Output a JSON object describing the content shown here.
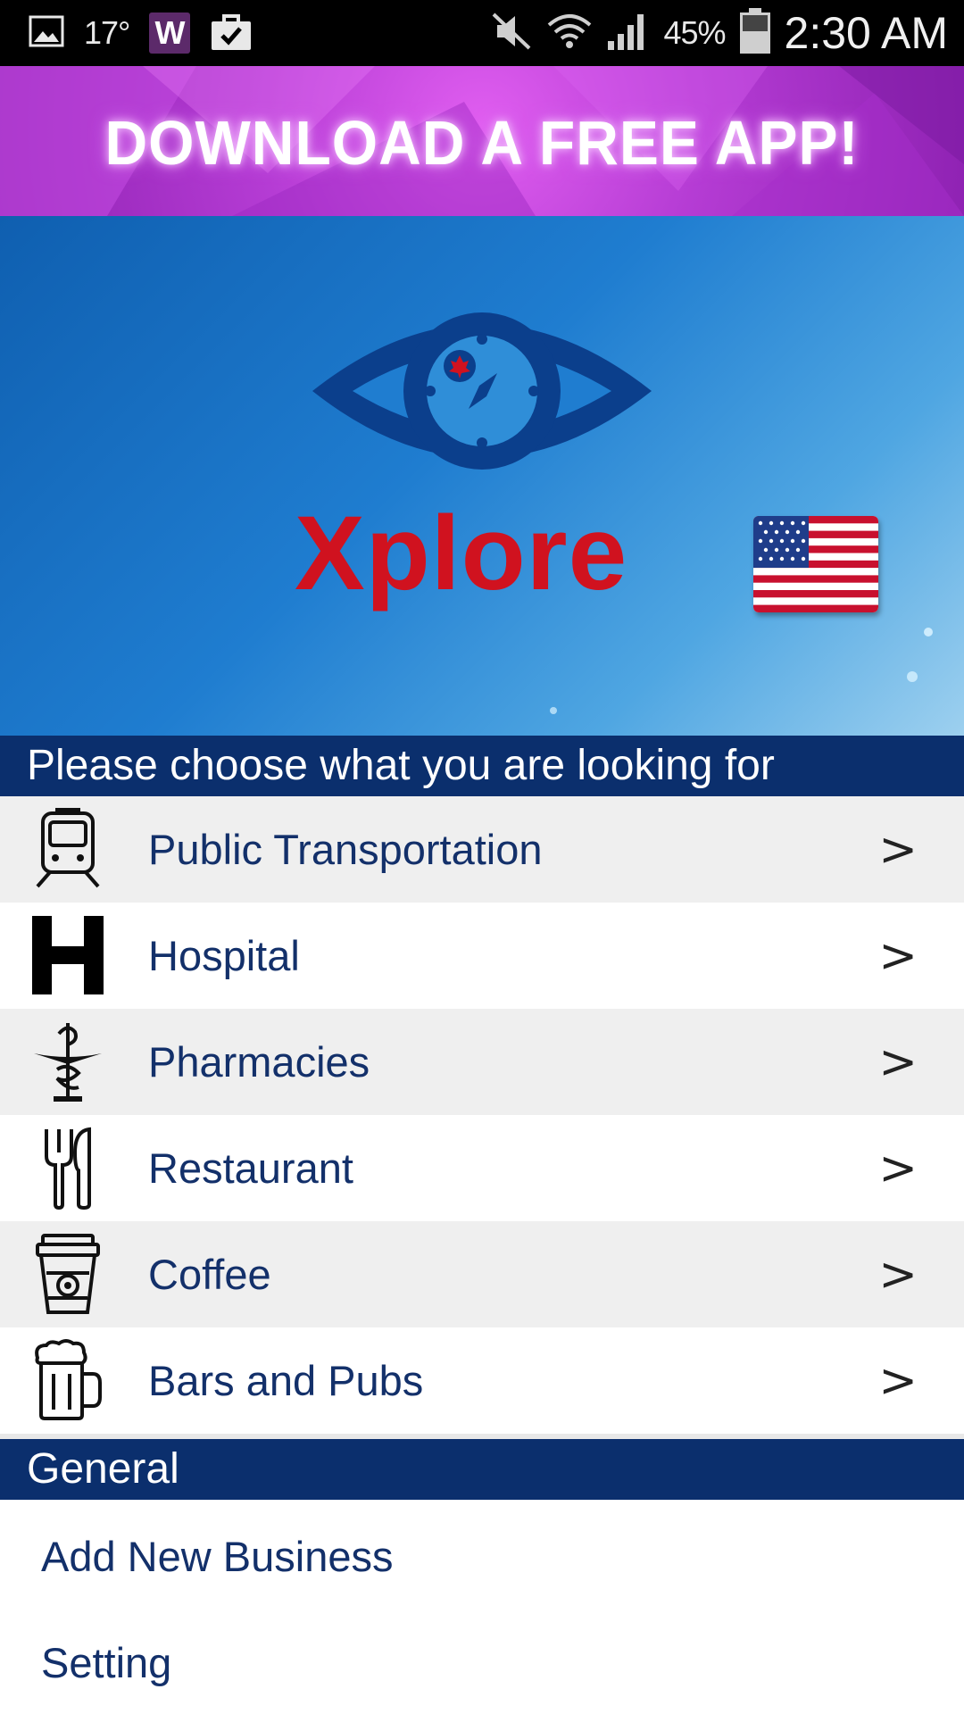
{
  "status_bar": {
    "temperature": "17°",
    "battery": "45%",
    "time": "2:30 AM",
    "icons": [
      "gallery-icon",
      "w-app-icon",
      "shopping-bag-icon",
      "mute-icon",
      "wifi-icon",
      "signal-icon",
      "battery-icon"
    ]
  },
  "ad_banner": {
    "text": "DOWNLOAD A FREE APP!"
  },
  "hero": {
    "title": "Xplore",
    "logo_icon": "eye-compass-icon",
    "flag_icon": "us-flag-icon"
  },
  "prompt": {
    "text": "Please choose what you are looking for"
  },
  "categories": [
    {
      "label": "Public Transportation",
      "icon": "train-icon",
      "chevron": ">"
    },
    {
      "label": "Hospital",
      "icon": "hospital-h-icon",
      "chevron": ">"
    },
    {
      "label": "Pharmacies",
      "icon": "pharmacy-caduceus-icon",
      "chevron": ">"
    },
    {
      "label": "Restaurant",
      "icon": "fork-knife-icon",
      "chevron": ">"
    },
    {
      "label": "Coffee",
      "icon": "coffee-cup-icon",
      "chevron": ">"
    },
    {
      "label": "Bars and Pubs",
      "icon": "beer-mug-icon",
      "chevron": ">"
    }
  ],
  "general": {
    "header": "General",
    "items": [
      {
        "label": "Add New Business"
      },
      {
        "label": "Setting"
      }
    ]
  },
  "colors": {
    "header_navy": "#0b2f6d",
    "label_navy": "#13306a",
    "title_red": "#d0121f",
    "row_gray": "#efefef"
  }
}
